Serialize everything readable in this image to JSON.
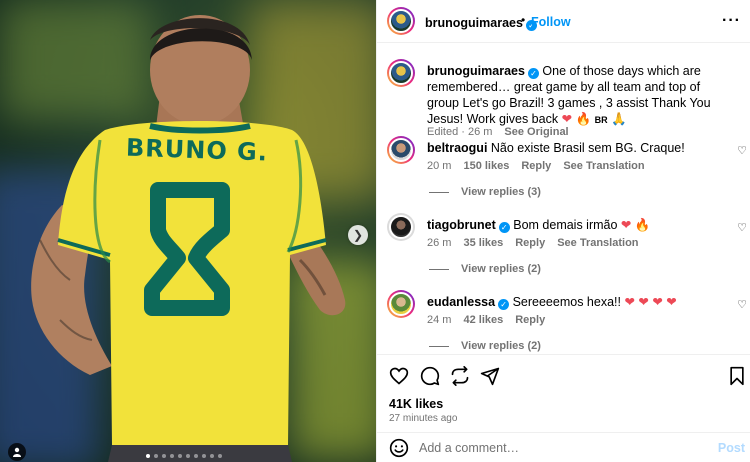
{
  "post": {
    "author": "brunoguimaraes",
    "follow_label": "Follow",
    "separator": "•",
    "more_label": "···",
    "caption": "One of those days which are remembered… great game by all team and top of group Let's go Brazil! 3 games , 3 assist Thank You Jesus! Work gives back",
    "caption_flag": "BR",
    "caption_edited": "Edited · 26 m",
    "see_original": "See Original",
    "likes": "41K likes",
    "time_ago": "27 minutes ago",
    "add_comment_placeholder": "Add a comment…",
    "post_label": "Post"
  },
  "photo": {
    "jersey_name": "BRUNO G.",
    "jersey_number": "8",
    "active_slide": 1,
    "slide_count": 10
  },
  "comments": [
    {
      "username": "beltraogui",
      "verified": false,
      "text": "Não existe Brasil sem BG. Craque!",
      "time": "20 m",
      "likes": "150 likes",
      "reply_label": "Reply",
      "translation_label": "See Translation",
      "view_replies": "View replies (3)"
    },
    {
      "username": "tiagobrunet",
      "verified": true,
      "text": "Bom demais irmão",
      "time": "26 m",
      "likes": "35 likes",
      "reply_label": "Reply",
      "translation_label": "See Translation",
      "view_replies": "View replies (2)"
    },
    {
      "username": "eudanlessa",
      "verified": true,
      "text": "Sereeeemos hexa!!",
      "time": "24 m",
      "likes": "42 likes",
      "reply_label": "Reply",
      "translation_label": "",
      "view_replies": "View replies (2)"
    }
  ],
  "colors": {
    "accent": "#0095f6",
    "heart": "#ed4956",
    "muted": "#737373",
    "jersey": "#f2e23a",
    "jersey_trim": "#0d6a5a"
  },
  "icons": {
    "header": [
      "verified-badge-icon",
      "more-options-icon"
    ],
    "actions": [
      "heart-icon",
      "comment-icon",
      "share-icon",
      "send-icon",
      "bookmark-icon"
    ],
    "photo": [
      "next-slide-icon",
      "tagged-user-icon"
    ],
    "input": [
      "emoji-icon"
    ]
  }
}
